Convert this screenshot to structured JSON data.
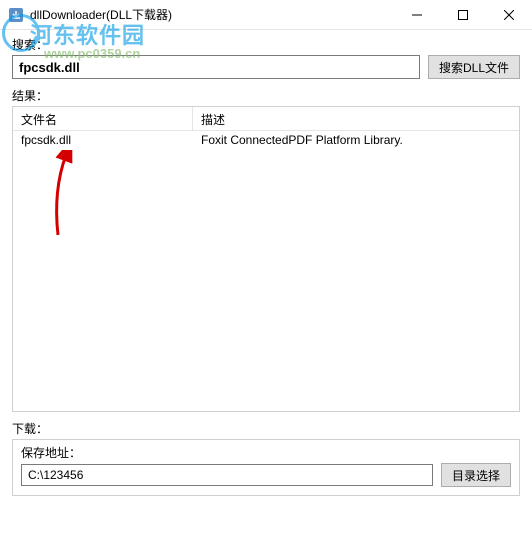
{
  "window": {
    "title": "dllDownloader(DLL下载器)"
  },
  "search": {
    "label": "搜索：",
    "value": "fpcsdk.dll",
    "button": "搜索DLL文件"
  },
  "results": {
    "label": "结果：",
    "columns": {
      "name": "文件名",
      "desc": "描述"
    },
    "rows": [
      {
        "name": "fpcsdk.dll",
        "desc": "Foxit ConnectedPDF Platform Library."
      }
    ]
  },
  "download": {
    "label": "下载：",
    "path_label": "保存地址：",
    "path_value": "C:\\123456",
    "browse_button": "目录选择"
  },
  "watermark": {
    "text1": "河东软件园",
    "text2": "www.pc0359.cn"
  }
}
